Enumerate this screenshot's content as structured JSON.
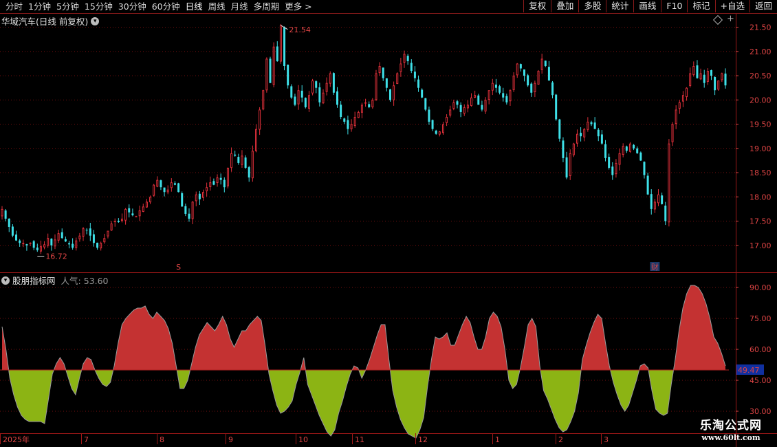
{
  "toolbar": {
    "periods": [
      "分时",
      "1分钟",
      "5分钟",
      "15分钟",
      "30分钟",
      "60分钟",
      "日线",
      "周线",
      "月线",
      "多周期",
      "更多 >"
    ],
    "tools": [
      "复权",
      "叠加",
      "多股",
      "统计",
      "画线",
      "F10",
      "标记",
      "+自选",
      "返回"
    ]
  },
  "main_panel": {
    "title": "华域汽车(日线 前复权)",
    "high_label": "21.54",
    "low_label": "16.72",
    "marker_s": "S",
    "marker_cai": "财"
  },
  "indicator_panel": {
    "title": "股朋指标网",
    "value_text": "人气: 53.60",
    "current_value_badge": "49.47"
  },
  "watermark": {
    "title": "乐淘公式网",
    "url": "www.60lt.com"
  },
  "colors": {
    "up": "#e0303a",
    "down": "#3ee0e8",
    "fill_up": "#c43232",
    "fill_down": "#8cb414",
    "grid": "#7a1010",
    "axis": "#e04545"
  },
  "chart_data": [
    {
      "type": "candlestick",
      "title": "华域汽车(日线 前复权)",
      "y_ticks": [
        "17.00",
        "17.50",
        "18.00",
        "18.50",
        "19.00",
        "19.50",
        "20.00",
        "20.50",
        "21.00",
        "21.50"
      ],
      "ylim": [
        16.5,
        21.75
      ],
      "annotations": [
        {
          "text": "21.54",
          "value": 21.54
        },
        {
          "text": "16.72",
          "value": 16.72
        }
      ],
      "closes": [
        17.75,
        17.55,
        17.38,
        17.2,
        17.1,
        17.05,
        17.05,
        17.0,
        17.05,
        16.95,
        16.9,
        16.98,
        17.02,
        17.15,
        17.0,
        17.12,
        17.25,
        17.15,
        17.08,
        17.02,
        16.95,
        17.1,
        17.2,
        17.35,
        17.32,
        17.2,
        17.05,
        16.95,
        17.05,
        17.15,
        17.3,
        17.45,
        17.5,
        17.48,
        17.55,
        17.75,
        17.68,
        17.62,
        17.6,
        17.72,
        17.8,
        17.9,
        18.0,
        18.25,
        18.35,
        18.2,
        18.1,
        18.15,
        18.3,
        18.25,
        18.1,
        17.8,
        17.65,
        17.55,
        17.9,
        18.05,
        17.95,
        18.1,
        18.2,
        18.3,
        18.25,
        18.4,
        18.35,
        18.2,
        18.6,
        18.9,
        18.85,
        18.7,
        18.85,
        18.6,
        18.4,
        18.95,
        19.4,
        19.8,
        20.2,
        20.85,
        20.35,
        21.1,
        20.8,
        21.54,
        20.7,
        20.3,
        20.05,
        19.9,
        20.2,
        20.05,
        19.85,
        20.1,
        20.4,
        20.25,
        19.95,
        20.15,
        20.35,
        20.55,
        20.15,
        19.9,
        19.65,
        19.55,
        19.4,
        19.5,
        19.65,
        19.75,
        19.9,
        19.95,
        19.85,
        20.0,
        20.55,
        20.7,
        20.45,
        20.25,
        20.0,
        20.3,
        20.55,
        20.75,
        20.95,
        20.8,
        20.6,
        20.45,
        20.25,
        20.05,
        19.8,
        19.55,
        19.4,
        19.3,
        19.35,
        19.5,
        19.65,
        19.8,
        19.95,
        19.9,
        19.75,
        19.85,
        19.9,
        20.05,
        20.1,
        19.9,
        19.8,
        20.0,
        20.2,
        20.35,
        20.25,
        20.15,
        20.05,
        19.95,
        20.2,
        20.5,
        20.75,
        20.65,
        20.5,
        20.3,
        20.15,
        20.35,
        20.6,
        20.85,
        20.7,
        20.4,
        20.1,
        19.6,
        19.2,
        18.8,
        18.4,
        18.9,
        19.1,
        19.3,
        19.25,
        19.4,
        19.55,
        19.5,
        19.4,
        19.25,
        19.1,
        18.8,
        18.6,
        18.45,
        18.7,
        18.9,
        19.05,
        18.95,
        19.1,
        19.0,
        18.9,
        18.75,
        18.45,
        18.05,
        17.75,
        17.9,
        18.05,
        17.85,
        17.5,
        19.1,
        19.5,
        19.8,
        19.95,
        20.1,
        20.25,
        20.55,
        20.7,
        20.45,
        20.55,
        20.35,
        20.6,
        20.5,
        20.2,
        20.4,
        20.55,
        20.3
      ]
    },
    {
      "type": "area",
      "title": "股朋指标网",
      "y_ticks": [
        "30.00",
        "45.00",
        "60.00",
        "75.00",
        "90.00"
      ],
      "ylim": [
        20,
        96
      ],
      "baseline": 50,
      "values": [
        71,
        60,
        46,
        38,
        32,
        28,
        26,
        25,
        25,
        25,
        25,
        24,
        36,
        48,
        53,
        56,
        53,
        47,
        41,
        38,
        46,
        53,
        56,
        55,
        50,
        46,
        43,
        42,
        44,
        52,
        63,
        72,
        75,
        77,
        79,
        80,
        80,
        81,
        77,
        75,
        78,
        76,
        74,
        70,
        63,
        52,
        41,
        41,
        45,
        53,
        61,
        67,
        70,
        73,
        71,
        69,
        72,
        76,
        72,
        65,
        61,
        65,
        69,
        69,
        72,
        74,
        76,
        74,
        62,
        48,
        40,
        33,
        29,
        30,
        32,
        35,
        43,
        49,
        56,
        43,
        38,
        33,
        28,
        24,
        20,
        18,
        21,
        29,
        35,
        42,
        48,
        52,
        51,
        46,
        50,
        55,
        61,
        67,
        72,
        72,
        55,
        40,
        32,
        26,
        22,
        19,
        18,
        17,
        21,
        27,
        42,
        55,
        66,
        65,
        66,
        68,
        62,
        62,
        67,
        72,
        76,
        73,
        66,
        60,
        60,
        66,
        75,
        78,
        76,
        71,
        60,
        45,
        41,
        43,
        51,
        61,
        72,
        75,
        71,
        52,
        40,
        36,
        31,
        26,
        22,
        20,
        21,
        25,
        30,
        39,
        55,
        62,
        68,
        73,
        77,
        75,
        63,
        52,
        44,
        38,
        33,
        30,
        33,
        39,
        45,
        52,
        53,
        51,
        40,
        31,
        29,
        28,
        29,
        43,
        55,
        69,
        80,
        87,
        91,
        91,
        90,
        87,
        82,
        75,
        66,
        63,
        58,
        52
      ]
    }
  ]
}
